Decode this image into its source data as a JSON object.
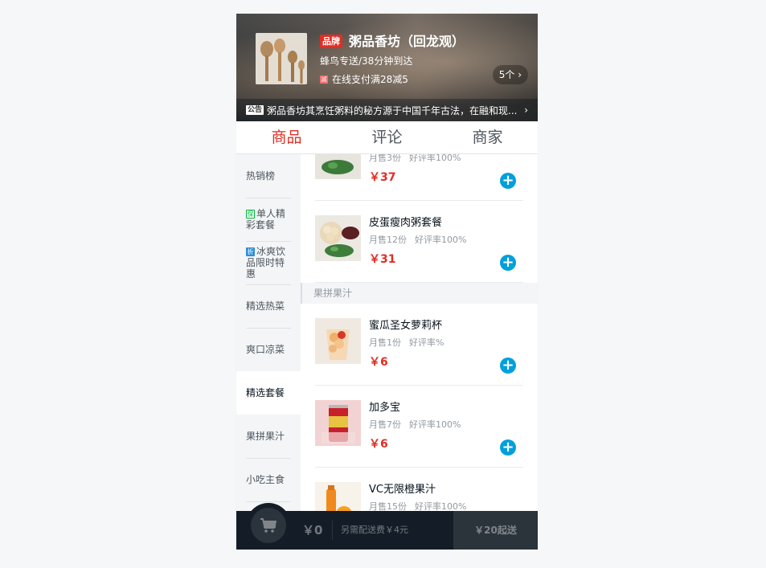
{
  "seller": {
    "brand_badge": "品牌",
    "name": "粥品香坊（回龙观）",
    "delivery": "蜂鸟专送/38分钟到达",
    "promo_icon": "减",
    "promo_text": "在线支付满28减5",
    "promo_count": "5个 ›",
    "notice_tag": "公告",
    "notice_text": "粥品香坊其烹饪粥料的秘方源于中国千年古法，在融和现...",
    "notice_arrow": "›"
  },
  "tabs": [
    {
      "label": "商品",
      "active": true
    },
    {
      "label": "评论",
      "active": false
    },
    {
      "label": "商家",
      "active": false
    }
  ],
  "menu": {
    "items": [
      {
        "label": "热销榜",
        "badge": ""
      },
      {
        "label": "单人精彩套餐",
        "badge": "保"
      },
      {
        "label": "冰爽饮品限时特惠",
        "badge": "折"
      },
      {
        "label": "精选热菜",
        "badge": ""
      },
      {
        "label": "爽口凉菜",
        "badge": ""
      },
      {
        "label": "精选套餐",
        "badge": "",
        "active": true
      },
      {
        "label": "果拼果汁",
        "badge": ""
      },
      {
        "label": "小吃主食",
        "badge": ""
      }
    ]
  },
  "foods": {
    "partial_top": {
      "sales": "月售3份",
      "rating": "好评率100%",
      "price": "￥37"
    },
    "items": [
      {
        "name": "皮蛋瘦肉粥套餐",
        "sales": "月售12份",
        "rating": "好评率100%",
        "price": "￥31"
      }
    ],
    "category_header": "果拼果汁",
    "category_items": [
      {
        "name": "蜜瓜圣女萝莉杯",
        "sales": "月售1份",
        "rating": "好评率%",
        "price": "￥6"
      },
      {
        "name": "加多宝",
        "sales": "月售7份",
        "rating": "好评率100%",
        "price": "￥6"
      },
      {
        "name": "VC无限橙果汁",
        "sales": "月售15份",
        "rating": "好评率100%",
        "price": ""
      }
    ],
    "add_label": "+"
  },
  "cart": {
    "icon": "cart-icon",
    "total": "￥0",
    "delivery_fee": "另需配送费￥4元",
    "min_order": "￥20起送"
  },
  "colors": {
    "accent_red": "#e02e24",
    "add_blue": "#00a0dc",
    "cart_dark": "#141d27"
  }
}
